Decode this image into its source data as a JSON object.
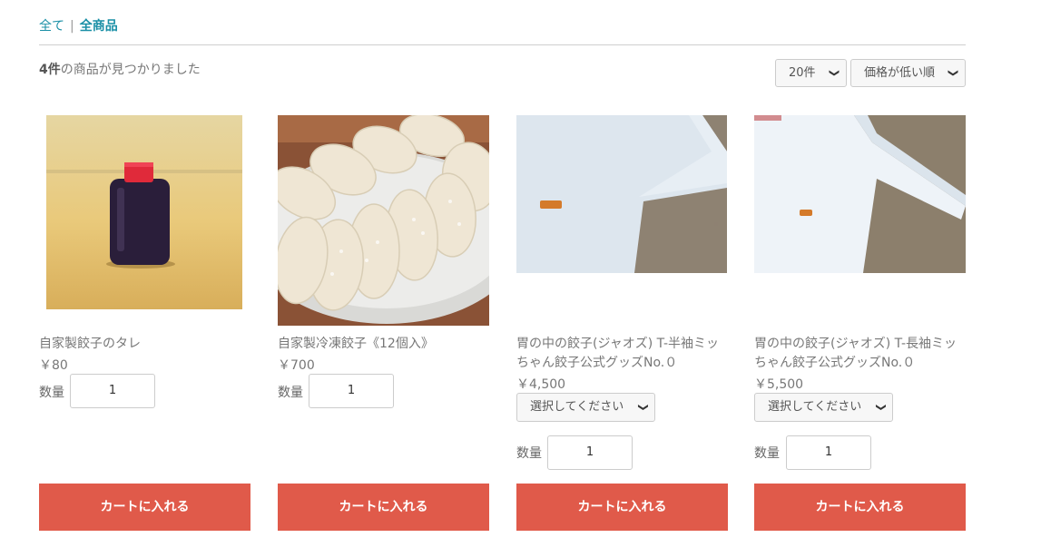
{
  "breadcrumb": {
    "all": "全て",
    "separator": "|",
    "current": "全商品"
  },
  "results": {
    "count": "4件",
    "suffix": "の商品が見つかりました"
  },
  "per_page": {
    "selected": "20件"
  },
  "sort": {
    "selected": "価格が低い順"
  },
  "products": [
    {
      "name": "自家製餃子のタレ",
      "price": "￥80",
      "qty_label": "数量",
      "qty": "1",
      "cart_label": "カートに入れる"
    },
    {
      "name": "自家製冷凍餃子《12個入》",
      "price": "￥700",
      "qty_label": "数量",
      "qty": "1",
      "cart_label": "カートに入れる"
    },
    {
      "name": "胃の中の餃子(ジャオズ) T-半袖ミッちゃん餃子公式グッズNo.０",
      "price": "￥4,500",
      "variant_placeholder": "選択してください",
      "qty_label": "数量",
      "qty": "1",
      "cart_label": "カートに入れる"
    },
    {
      "name": "胃の中の餃子(ジャオズ) T-長袖ミッちゃん餃子公式グッズNo.０",
      "price": "￥5,500",
      "variant_placeholder": "選択してください",
      "qty_label": "数量",
      "qty": "1",
      "cart_label": "カートに入れる"
    }
  ],
  "colors": {
    "accent": "#1a8fa6",
    "cart_button": "#e05a4a"
  }
}
